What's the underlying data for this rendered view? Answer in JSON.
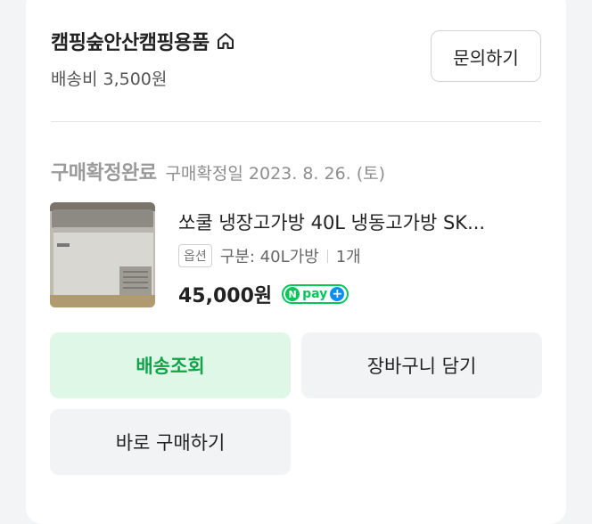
{
  "store": {
    "name": "캠핑숲안산캠핑용품",
    "shipping_fee": "배송비 3,500원",
    "inquiry_label": "문의하기",
    "home_icon": "home-icon"
  },
  "order": {
    "status": "구매확정완료",
    "confirm_date": "구매확정일 2023. 8. 26. (토)"
  },
  "product": {
    "title": "쏘쿨 냉장고가방 40L 냉동고가방 SK...",
    "option_badge": "옵션",
    "option_text": "구분: 40L가방",
    "quantity": "1개",
    "price": "45,000원",
    "npay": {
      "n": "N",
      "text": "pay",
      "plus": "+"
    }
  },
  "actions": {
    "track_label": "배송조회",
    "cart_label": "장바구니 담기",
    "buy_again_label": "바로 구매하기"
  },
  "colors": {
    "accent_green": "#14a24b",
    "npay_green": "#03c75a",
    "npay_blue": "#0e8ef0"
  }
}
